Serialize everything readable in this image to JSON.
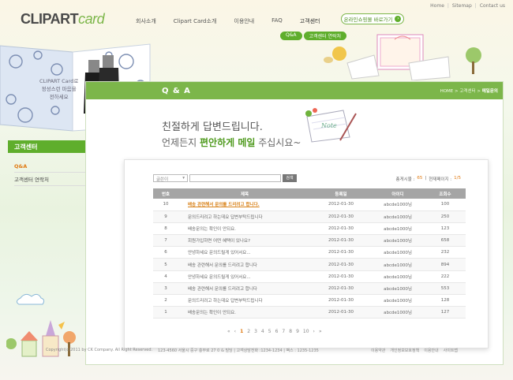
{
  "brand": {
    "logo_main": "CLIPART",
    "logo_sub": "card"
  },
  "top_links": [
    "Home",
    "Sitemap",
    "Contact us"
  ],
  "gnb": [
    "회사소개",
    "Clipart Card소개",
    "이용안내",
    "FAQ",
    "고객센터"
  ],
  "sub_gnb": [
    "Q&A",
    "고객센터 연락처"
  ],
  "mall_button": "온라인쇼핑몰 바로가기",
  "hero_text": [
    "CLIPART Card로",
    "정성스런 마음을",
    "전하세요"
  ],
  "sidebar": {
    "title": "고객센터",
    "items": [
      "Q&A",
      "고객센터 연락처"
    ]
  },
  "panel": {
    "title": "Q & A",
    "breadcrumb_home": "HOME",
    "breadcrumb_mid": "고객센터",
    "breadcrumb_current": "메일문의",
    "intro_line1": "친절하게 답변드립니다.",
    "intro_line2_pre": "언제든지 ",
    "intro_line2_hl": "편안하게 메일",
    "intro_line2_post": " 주십시요~",
    "note_label": "Note"
  },
  "board": {
    "select_value": "글쓴이",
    "search_button": "검색",
    "total_label": "총게시물 :",
    "total_value": "65",
    "page_label": "현재페이지 :",
    "page_value": "1/5",
    "columns": [
      "번호",
      "제목",
      "등록일",
      "아이디",
      "조회수"
    ],
    "rows": [
      [
        "10",
        "배송 관련해서 문의를 드리려고 합니다.",
        "2012-01-30",
        "abcde1000님",
        "100"
      ],
      [
        "9",
        "문의드리려고 하는데요 답변부탁드립니다",
        "2012-01-30",
        "abcde1000님",
        "250"
      ],
      [
        "8",
        "배송문의는 확인이 안되요.",
        "2012-01-30",
        "abcde1000님",
        "123"
      ],
      [
        "7",
        "회원가입하면 어떤 혜택이 있나요?",
        "2012-01-30",
        "abcde1000님",
        "658"
      ],
      [
        "6",
        "안녕하세요 문의드릴게 있어서요...",
        "2012-01-30",
        "abcde1000님",
        "232"
      ],
      [
        "5",
        "배송 관련해서 문의를 드리려고 합니다",
        "2012-01-30",
        "abcde1000님",
        "894"
      ],
      [
        "4",
        "안녕하세요 문의드릴게 있어서요...",
        "2012-01-30",
        "abcde1000님",
        "222"
      ],
      [
        "3",
        "배송 관련해서 문의를 드리려고 합니다",
        "2012-01-30",
        "abcde1000님",
        "553"
      ],
      [
        "2",
        "문의드리려고 하는데요 답변부탁드립니다",
        "2012-01-30",
        "abcde1000님",
        "128"
      ],
      [
        "1",
        "배송문의는 확인이 안되요.",
        "2012-01-30",
        "abcde1000님",
        "127"
      ]
    ],
    "pager": {
      "first": "«",
      "prev": "‹",
      "pages": [
        "1",
        "2",
        "3",
        "4",
        "5",
        "6",
        "7",
        "8",
        "9",
        "10"
      ],
      "next": "›",
      "last": "»"
    }
  },
  "footer": {
    "copyright": "Copyright(c)2011 by CK Company. All Right Reserved.",
    "address": "123-4560 서울시 중구 충무로 27 0 & 빌딩 | 고객상담전화 :1234-1234 | 팩스 : 1235-1235",
    "links": [
      "이용약관",
      "개인정보보호정책",
      "이용안내",
      "사이트맵"
    ]
  },
  "colors": {
    "accent": "#7cb64a",
    "accent_dark": "#5fae2c",
    "highlight": "#e07a12"
  }
}
